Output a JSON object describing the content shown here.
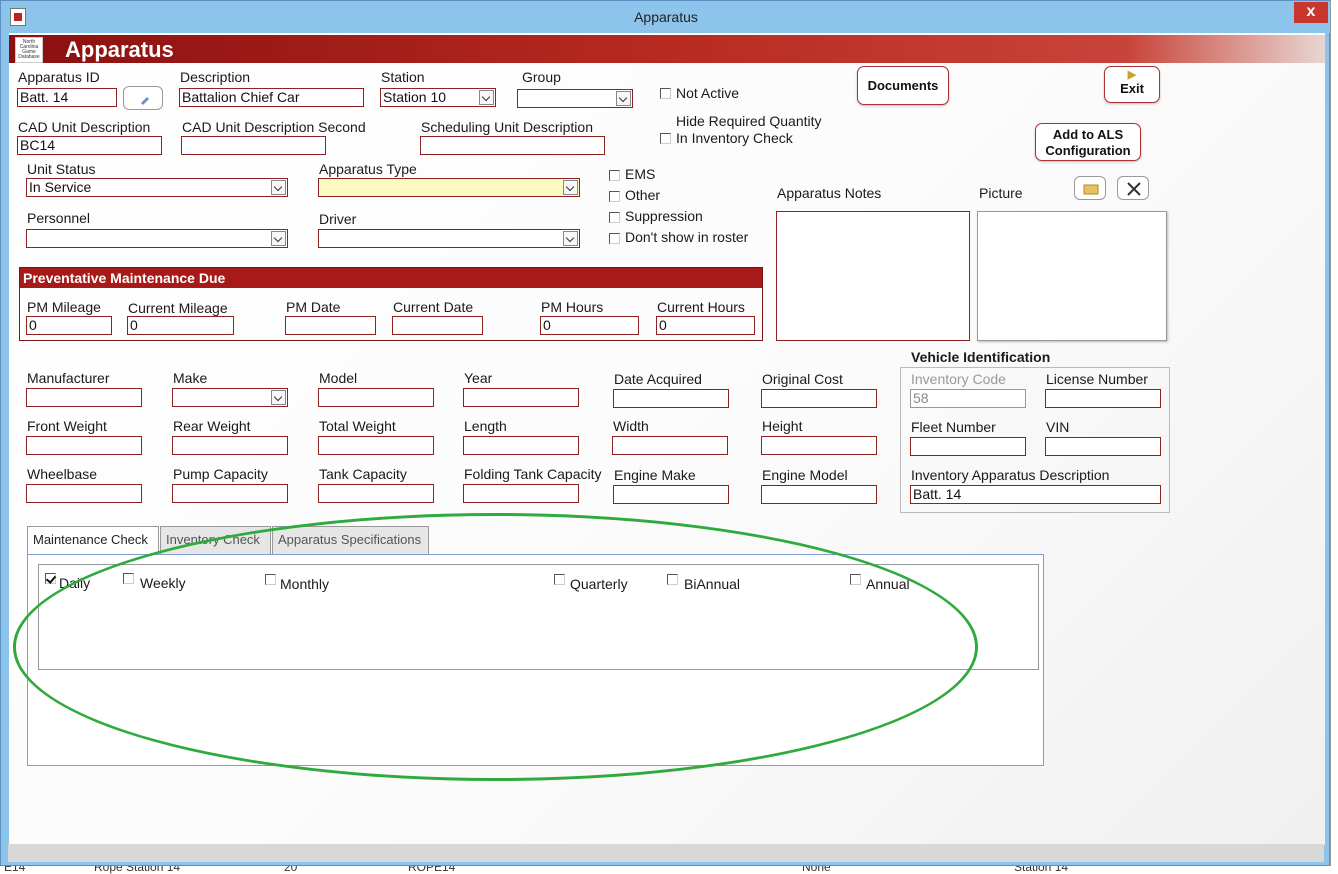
{
  "window": {
    "title": "Apparatus",
    "close_label": "x"
  },
  "header": {
    "title": "Apparatus",
    "logo_text": "North Carolina Game Database"
  },
  "fields": {
    "apparatus_id": {
      "label": "Apparatus ID",
      "value": "Batt. 14"
    },
    "description": {
      "label": "Description",
      "value": "Battalion Chief Car"
    },
    "station": {
      "label": "Station",
      "value": "Station 10"
    },
    "group": {
      "label": "Group",
      "value": ""
    },
    "cad_unit_description": {
      "label": "CAD Unit Description",
      "value": "BC14"
    },
    "cad_unit_description_second": {
      "label": "CAD Unit Description Second",
      "value": ""
    },
    "scheduling_unit_description": {
      "label": "Scheduling Unit Description",
      "value": ""
    },
    "unit_status": {
      "label": "Unit Status",
      "value": "In Service"
    },
    "apparatus_type": {
      "label": "Apparatus Type",
      "value": ""
    },
    "personnel": {
      "label": "Personnel",
      "value": ""
    },
    "driver": {
      "label": "Driver",
      "value": ""
    },
    "manufacturer": {
      "label": "Manufacturer",
      "value": ""
    },
    "make": {
      "label": "Make",
      "value": ""
    },
    "model": {
      "label": "Model",
      "value": ""
    },
    "year": {
      "label": "Year",
      "value": ""
    },
    "date_acquired": {
      "label": "Date Acquired",
      "value": ""
    },
    "original_cost": {
      "label": "Original Cost",
      "value": ""
    },
    "front_weight": {
      "label": "Front Weight",
      "value": ""
    },
    "rear_weight": {
      "label": "Rear Weight",
      "value": ""
    },
    "total_weight": {
      "label": "Total Weight",
      "value": ""
    },
    "length": {
      "label": "Length",
      "value": ""
    },
    "width": {
      "label": "Width",
      "value": ""
    },
    "height": {
      "label": "Height",
      "value": ""
    },
    "wheelbase": {
      "label": "Wheelbase",
      "value": ""
    },
    "pump_capacity": {
      "label": "Pump Capacity",
      "value": ""
    },
    "tank_capacity": {
      "label": "Tank Capacity",
      "value": ""
    },
    "folding_tank_capacity": {
      "label": "Folding Tank Capacity",
      "value": ""
    },
    "engine_make": {
      "label": "Engine Make",
      "value": ""
    },
    "engine_model": {
      "label": "Engine Model",
      "value": ""
    }
  },
  "checkboxes": {
    "not_active": {
      "label": "Not Active",
      "checked": false
    },
    "hide_required_qty": {
      "label_line1": "Hide Required Quantity",
      "label_line2": "In Inventory Check",
      "checked": false
    },
    "ems": {
      "label": "EMS",
      "checked": false
    },
    "other": {
      "label": "Other",
      "checked": false
    },
    "suppression": {
      "label": "Suppression",
      "checked": false
    },
    "dont_show_roster": {
      "label": "Don't show in roster",
      "checked": false
    }
  },
  "buttons": {
    "documents": "Documents",
    "exit": "Exit",
    "add_als_line1": "Add to ALS",
    "add_als_line2": "Configuration"
  },
  "notes": {
    "label": "Apparatus  Notes"
  },
  "picture": {
    "label": "Picture"
  },
  "preventative_maintenance": {
    "title": "Preventative Maintenance Due",
    "pm_mileage": {
      "label": "PM Mileage",
      "value": "0"
    },
    "current_mileage": {
      "label": "Current Mileage",
      "value": "0"
    },
    "pm_date": {
      "label": "PM Date",
      "value": ""
    },
    "current_date": {
      "label": "Current Date",
      "value": ""
    },
    "pm_hours": {
      "label": "PM Hours",
      "value": "0"
    },
    "current_hours": {
      "label": "Current Hours",
      "value": "0"
    }
  },
  "vehicle_identification": {
    "title": "Vehicle Identification",
    "inventory_code": {
      "label": "Inventory Code",
      "value": "58"
    },
    "license_number": {
      "label": "License Number",
      "value": ""
    },
    "fleet_number": {
      "label": "Fleet Number",
      "value": ""
    },
    "vin": {
      "label": "VIN",
      "value": ""
    },
    "inventory_apparatus_description": {
      "label": "Inventory Apparatus Description",
      "value": "Batt. 14"
    }
  },
  "tabs": [
    {
      "label": "Maintenance  Check",
      "active": true
    },
    {
      "label": "Inventory Check",
      "active": false
    },
    {
      "label": "Apparatus Specifications",
      "active": false
    }
  ],
  "maintenance_check": [
    {
      "label": "Daily",
      "checked": true
    },
    {
      "label": "Weekly",
      "checked": false
    },
    {
      "label": "Monthly",
      "checked": false
    },
    {
      "label": "Quarterly",
      "checked": false
    },
    {
      "label": "BiAnnual",
      "checked": false
    },
    {
      "label": "Annual",
      "checked": false
    }
  ],
  "background_row": [
    "E14",
    "Rope Station 14",
    "20",
    "ROPE14",
    "None",
    "Station 14"
  ],
  "colors": {
    "header_red": "#a81a1a",
    "highlight_green": "#2faa3c",
    "titlebar_blue": "#8cc4ec"
  }
}
